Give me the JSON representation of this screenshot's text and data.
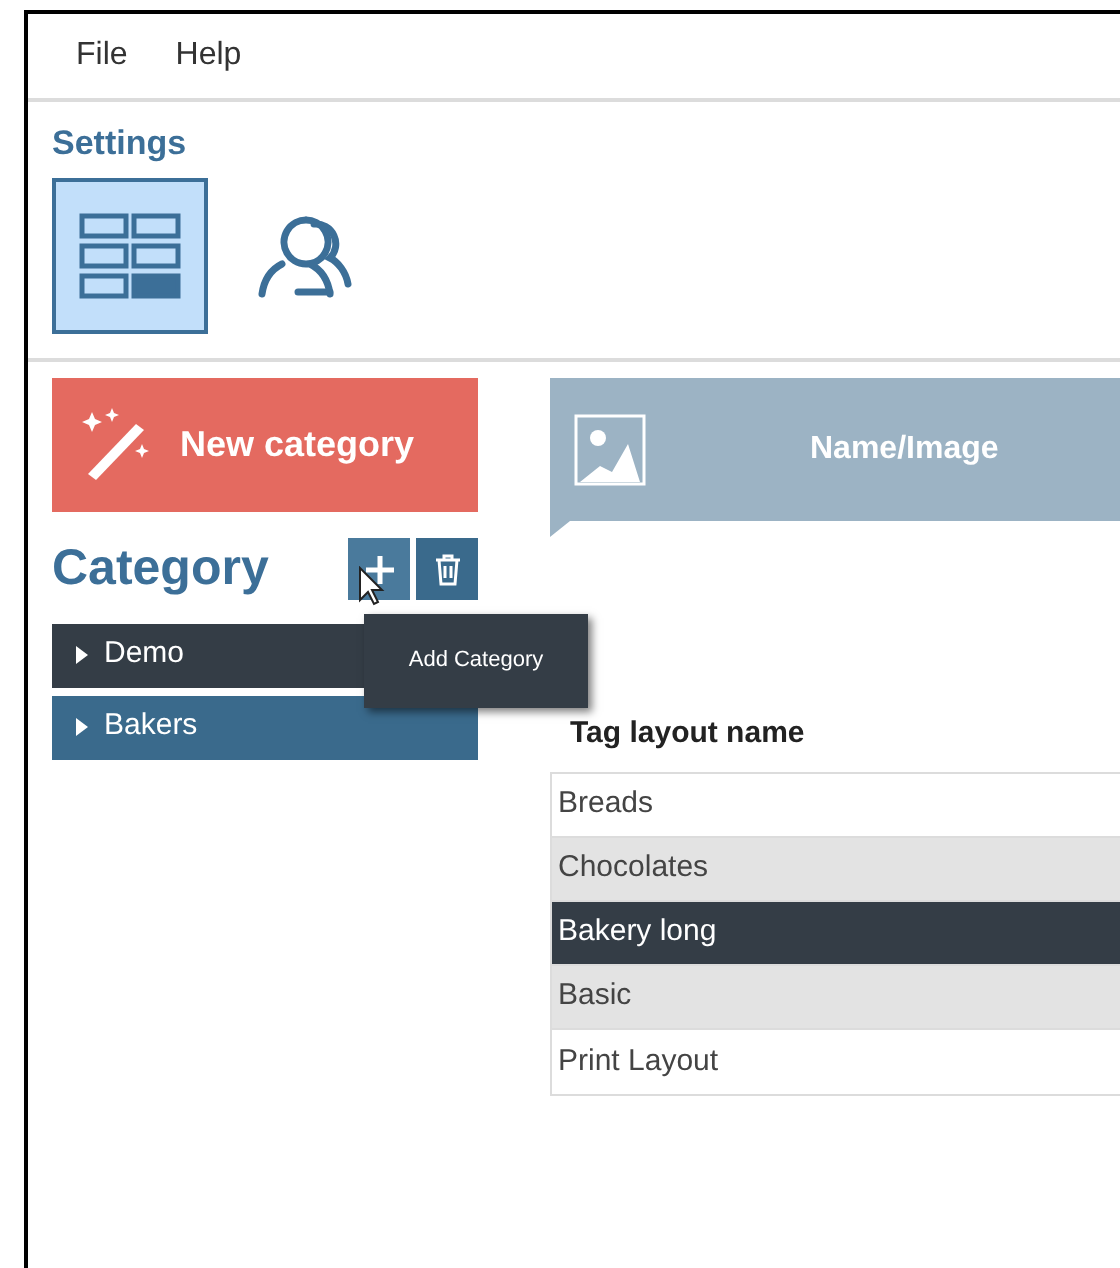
{
  "menu": [
    "File",
    "Help"
  ],
  "settings": {
    "title": "Settings",
    "tools": [
      {
        "kind": "layout",
        "selected": true
      },
      {
        "kind": "users",
        "selected": false
      }
    ]
  },
  "new_category_button": "New category",
  "category": {
    "title": "Category",
    "add_tooltip": "Add Category",
    "items": [
      {
        "label": "Demo",
        "selected": true
      },
      {
        "label": "Bakers",
        "selected": false
      }
    ]
  },
  "banner": {
    "label": "Name/Image"
  },
  "table": {
    "column": "Tag layout name",
    "rows": [
      {
        "name": "Breads",
        "selected": false
      },
      {
        "name": "Chocolates",
        "selected": false
      },
      {
        "name": "Bakery long",
        "selected": true
      },
      {
        "name": "Basic",
        "selected": false
      },
      {
        "name": "Print Layout",
        "selected": false
      }
    ]
  }
}
